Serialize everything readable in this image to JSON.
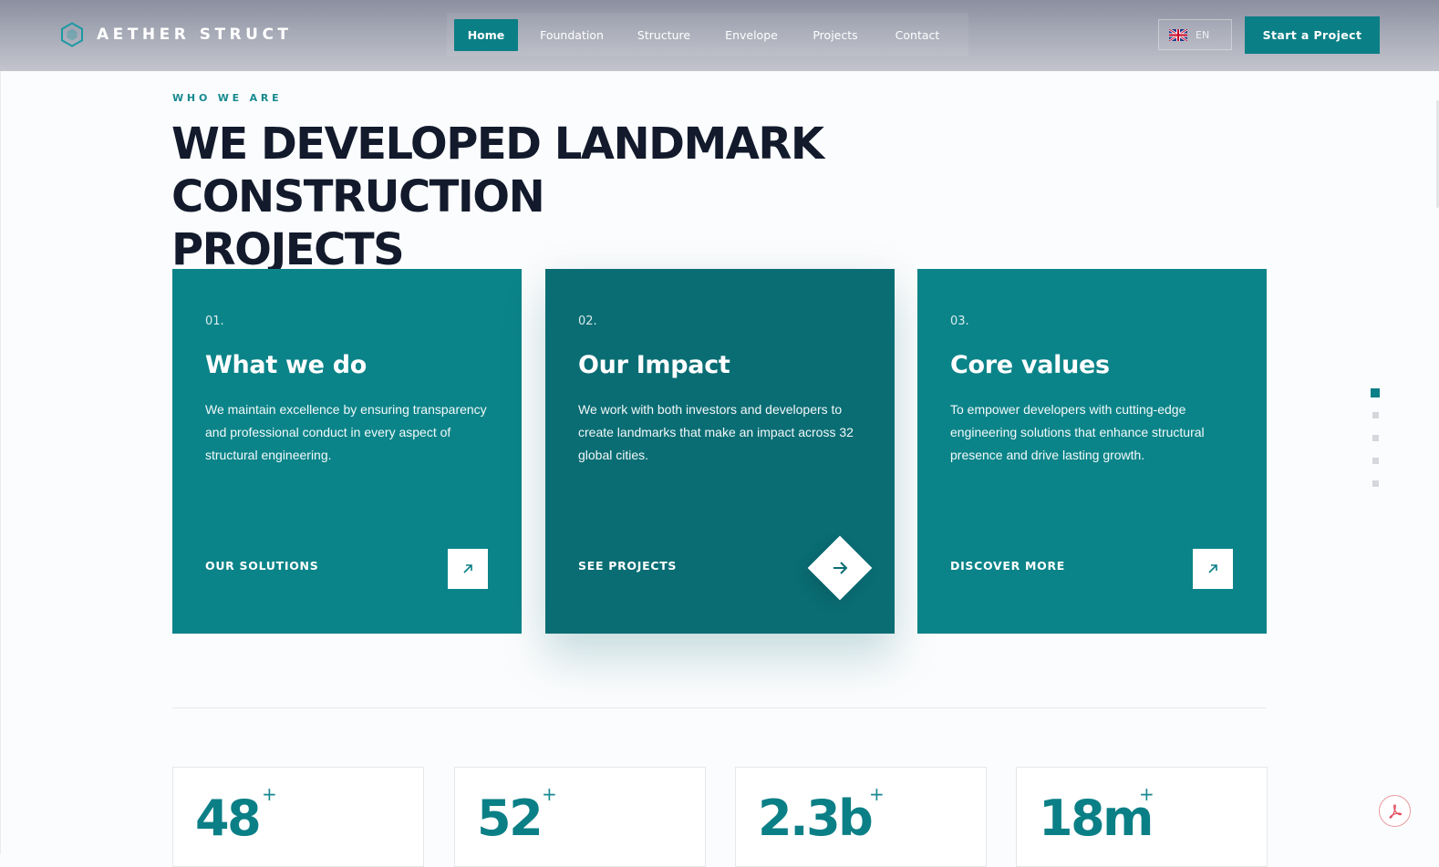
{
  "brand": {
    "name": "AETHER STRUCT",
    "accent": "#0b7f86"
  },
  "nav": {
    "items": [
      "Home",
      "Foundation",
      "Structure",
      "Envelope",
      "Projects",
      "Contact"
    ],
    "active": "Home"
  },
  "language": {
    "code": "EN",
    "flag_icon": "uk-flag-icon"
  },
  "cta": {
    "label": "Start a Project"
  },
  "intro": {
    "eyebrow": "WHO WE ARE",
    "headline_line1": "WE DEVELOPED LANDMARK CONSTRUCTION",
    "headline_line2": "PROJECTS"
  },
  "cards": [
    {
      "num": "01.",
      "title": "What we do",
      "text": "We maintain excellence by ensuring transparency and professional conduct in every aspect of structural engineering.",
      "link": "OUR SOLUTIONS",
      "icon": "arrow-up-right-icon"
    },
    {
      "num": "02.",
      "title": "Our Impact",
      "text": "We work with both investors and developers to create landmarks that make an impact across 32 global cities.",
      "link": "SEE PROJECTS",
      "icon": "arrow-right-icon"
    },
    {
      "num": "03.",
      "title": "Core values",
      "text": "To empower developers with cutting-edge engineering solutions that enhance structural presence and drive lasting growth.",
      "link": "DISCOVER MORE",
      "icon": "arrow-up-right-icon"
    }
  ],
  "side_nav": {
    "count": 5,
    "active_index": 0
  },
  "stats": [
    {
      "value": "48",
      "suffix": "+"
    },
    {
      "value": "52",
      "suffix": "+"
    },
    {
      "value": "2.3b",
      "suffix": "+"
    },
    {
      "value": "18m",
      "suffix": "+"
    }
  ],
  "floating": {
    "icon": "pdf-icon"
  }
}
